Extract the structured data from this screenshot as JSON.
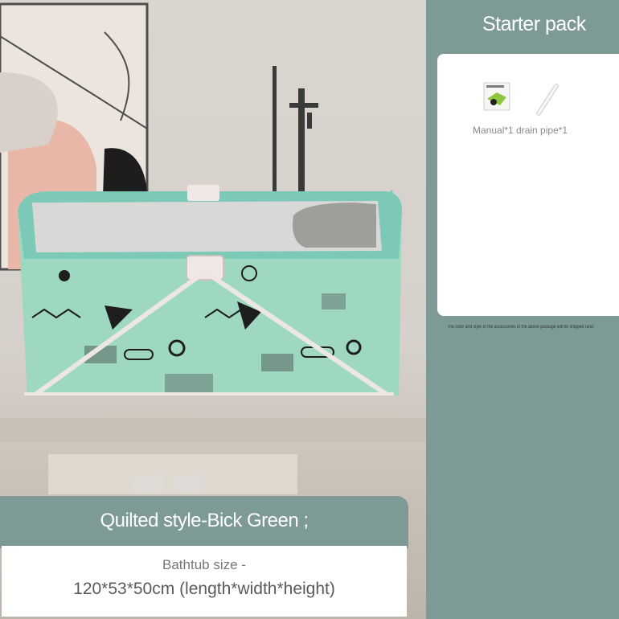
{
  "panel": {
    "title": "Starter pack",
    "accessories_caption": "Manual*1 drain pipe*1",
    "footnote": "The color and style of the accessories in the above package will be shipped randomly"
  },
  "product": {
    "style_name": "Quilted style-Bick Green ;",
    "size_label": "Bathtub size -",
    "size_value": "120*53*50cm (length*width*height)"
  },
  "colors": {
    "panel_bg": "#7d9a96",
    "tub_green": "#9fd8c0",
    "tub_rim": "#7cc9b7",
    "card_bg": "#ffffff"
  },
  "icons": [
    "manual-icon",
    "drain-pipe-icon"
  ]
}
